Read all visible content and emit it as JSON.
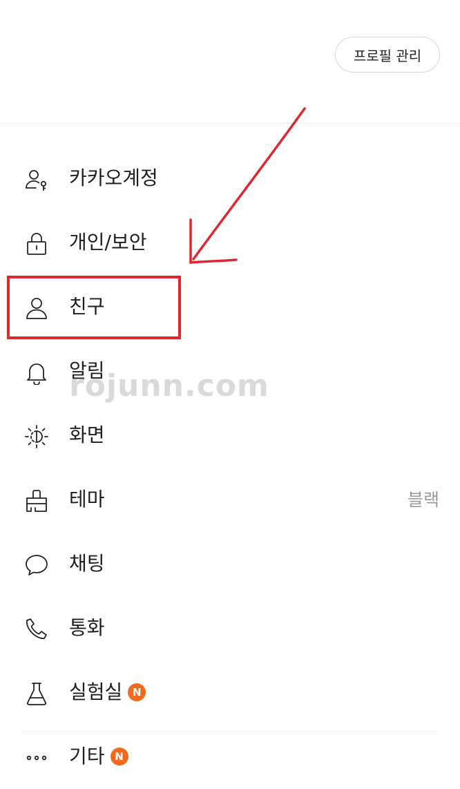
{
  "header": {
    "profile_button_label": "프로필 관리"
  },
  "menu": {
    "items": [
      {
        "label": "카카오계정",
        "icon": "account-key-icon"
      },
      {
        "label": "개인/보안",
        "icon": "lock-icon"
      },
      {
        "label": "친구",
        "icon": "person-icon"
      },
      {
        "label": "알림",
        "icon": "bell-icon"
      },
      {
        "label": "화면",
        "icon": "brightness-icon"
      },
      {
        "label": "테마",
        "icon": "paint-brush-icon",
        "value": "블랙"
      },
      {
        "label": "채팅",
        "icon": "chat-bubble-icon"
      },
      {
        "label": "통화",
        "icon": "phone-icon"
      },
      {
        "label": "실험실",
        "icon": "flask-icon",
        "badge": "N"
      },
      {
        "label": "기타",
        "icon": "more-dots-icon",
        "badge": "N"
      }
    ]
  },
  "watermark": "rojunn.com",
  "colors": {
    "highlight": "#e0262e",
    "badge": "#f26b1d",
    "divider": "#ececec"
  }
}
